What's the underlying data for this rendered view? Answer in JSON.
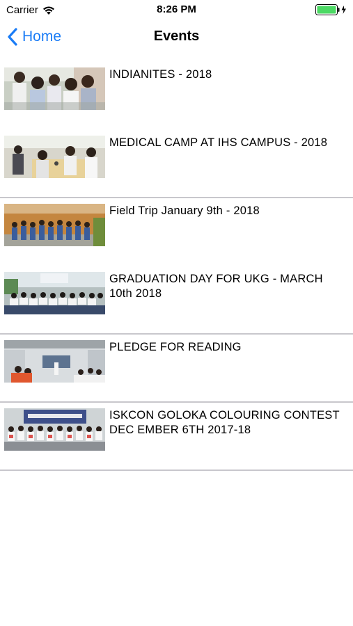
{
  "status_bar": {
    "carrier": "Carrier",
    "time": "8:26 PM",
    "battery_color": "#4cd964"
  },
  "nav": {
    "back_label": "Home",
    "title": "Events",
    "accent": "#1a7cf6"
  },
  "events": [
    {
      "title": "INDIANITES - 2018",
      "thumb": "children-group-photo",
      "divider": false
    },
    {
      "title": "MEDICAL CAMP AT IHS CAMPUS - 2018",
      "thumb": "medical-camp-photo",
      "divider": true
    },
    {
      "title": "Field Trip January 9th - 2018",
      "thumb": "field-trip-photo",
      "divider": false
    },
    {
      "title": "GRADUATION DAY FOR UKG - MARCH 10th 2018",
      "thumb": "graduation-photo",
      "divider": true
    },
    {
      "title": "PLEDGE FOR READING",
      "thumb": "pledge-reading-photo",
      "divider": true
    },
    {
      "title": "ISKCON GOLOKA COLOURING CONTEST DEC EMBER 6TH 2017-18",
      "thumb": "colouring-contest-photo",
      "divider": true
    }
  ]
}
